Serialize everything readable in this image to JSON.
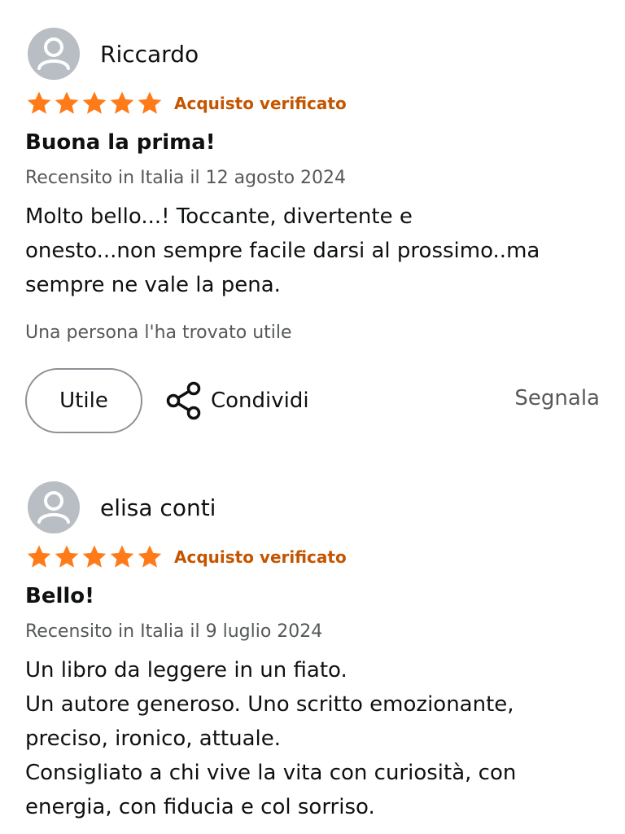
{
  "colors": {
    "star": "#ff7b1a",
    "verified": "#c45500",
    "meta": "#565959",
    "avatar_bg": "#b8bec3"
  },
  "reviews": [
    {
      "author": "Riccardo",
      "avatar_icon": "user-avatar-icon",
      "stars": 5,
      "verified_label": "Acquisto verificato",
      "title": "Buona la prima!",
      "meta": "Recensito in Italia il 12 agosto 2024",
      "body_lines": [
        "Molto bello...! Toccante, divertente e",
        "onesto...non sempre facile darsi al prossimo..ma",
        "sempre ne vale la pena."
      ],
      "helpful_text": "Una persona l'ha trovato utile",
      "helpful_button": "Utile",
      "share_icon": "share-icon",
      "share_label": "Condividi",
      "report_label": "Segnala"
    },
    {
      "author": "elisa conti",
      "avatar_icon": "user-avatar-icon",
      "stars": 5,
      "verified_label": "Acquisto verificato",
      "title": "Bello!",
      "meta": "Recensito in Italia il 9 luglio 2024",
      "body_lines": [
        "Un libro da leggere in un fiato.",
        "Un autore generoso. Uno scritto emozionante,",
        "preciso, ironico, attuale.",
        "Consigliato a chi vive la vita con curiosità, con",
        "energia, con fiducia e col sorriso."
      ]
    }
  ]
}
